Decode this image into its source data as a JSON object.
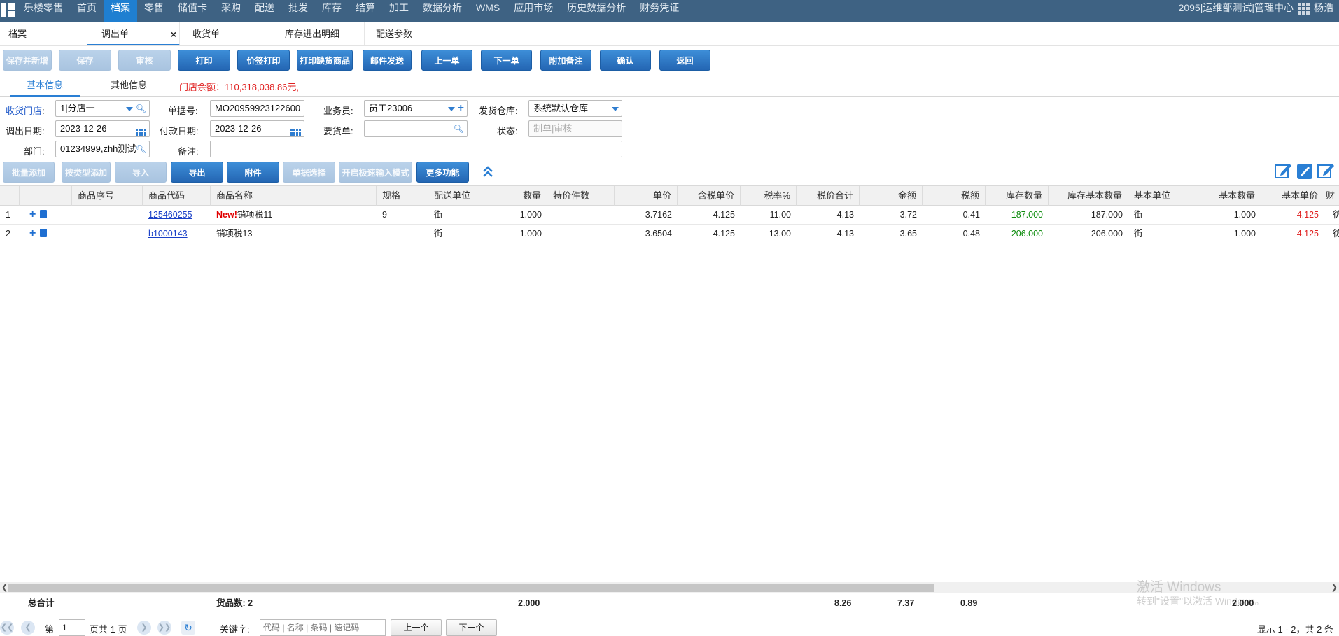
{
  "topnav": {
    "items": [
      "乐楼零售",
      "首页",
      "档案",
      "零售",
      "储值卡",
      "采购",
      "配送",
      "批发",
      "库存",
      "结算",
      "加工",
      "数据分析",
      "WMS",
      "应用市场",
      "历史数据分析",
      "财务凭证"
    ],
    "active_index": 2,
    "org": "2095|运维部测试|管理中心",
    "user": "杨浩"
  },
  "tabs": [
    {
      "label": "档案"
    },
    {
      "label": "调出单"
    },
    {
      "label": "收货单"
    },
    {
      "label": "库存进出明细"
    },
    {
      "label": "配送参数"
    }
  ],
  "tab_close": "×",
  "toolbar": {
    "buttons": [
      "保存并新增",
      "保存",
      "审核",
      "打印",
      "价签打印",
      "打印缺货商品",
      "邮件发送",
      "上一单",
      "下一单",
      "附加备注",
      "确认",
      "返回"
    ]
  },
  "subtabs": {
    "basic": "基本信息",
    "other": "其他信息",
    "balance": "门店余额：110,318,038.86元,"
  },
  "form": {
    "recv_store_label": "收货门店",
    "recv_store_value": "1|分店一",
    "bill_no_label": "单据号:",
    "bill_no_value": "MO20959923122600",
    "salesman_label": "业务员:",
    "salesman_value": "员工23006",
    "warehouse_label": "发货仓库:",
    "warehouse_value": "系统默认仓库",
    "out_date_label": "调出日期:",
    "out_date_value": "2023-12-26",
    "pay_date_label": "付款日期:",
    "pay_date_value": "2023-12-26",
    "req_bill_label": "要货单:",
    "req_bill_value": "",
    "status_label": "状态:",
    "status_placeholder": "制单|审核",
    "dept_label": "部门:",
    "dept_value": "01234999,zhh测试",
    "remark_label": "备注:",
    "remark_value": ""
  },
  "toolbar2": {
    "buttons": [
      "批量添加",
      "按类型添加",
      "导入",
      "导出",
      "附件",
      "单据选择",
      "开启极速输入模式",
      "更多功能"
    ],
    "collapse_icon": "double-chevron-up-icon"
  },
  "table": {
    "headers": [
      "商品序号",
      "商品代码",
      "商品名称",
      "规格",
      "配送单位",
      "数量",
      "特价件数",
      "单价",
      "含税单价",
      "税率%",
      "税价合计",
      "金额",
      "税额",
      "库存数量",
      "库存基本数量",
      "基本单位",
      "基本数量",
      "基本单价",
      "财"
    ],
    "rows": [
      {
        "idx": "1",
        "code": "125460255",
        "new": "New!",
        "name": "销项税11",
        "spec": "9",
        "unit": "街",
        "qty": "1.000",
        "special": "",
        "price": "3.7162",
        "tax_price": "4.125",
        "tax_rate": "11.00",
        "tax_total": "4.13",
        "amount": "3.72",
        "tax": "0.41",
        "stock": "187.000",
        "stock_base": "187.000",
        "base_unit": "街",
        "base_qty": "1.000",
        "base_price": "4.125",
        "extra": "彷"
      },
      {
        "idx": "2",
        "code": "b1000143",
        "new": "",
        "name": "销项税13",
        "spec": "",
        "unit": "街",
        "qty": "1.000",
        "special": "",
        "price": "3.6504",
        "tax_price": "4.125",
        "tax_rate": "13.00",
        "tax_total": "4.13",
        "amount": "3.65",
        "tax": "0.48",
        "stock": "206.000",
        "stock_base": "206.000",
        "base_unit": "街",
        "base_qty": "1.000",
        "base_price": "4.125",
        "extra": "彷"
      }
    ]
  },
  "totals": {
    "label": "总合计",
    "count": "货品数: 2",
    "qty": "2.000",
    "tax_total": "8.26",
    "amount": "7.37",
    "tax": "0.89",
    "base_qty": "2.000"
  },
  "pager": {
    "page_prefix": "第",
    "page_value": "1",
    "page_suffix": "页共 1 页",
    "keyword_label": "关键字:",
    "keyword_placeholder": "代码 | 名称 | 条码 | 速记码",
    "prev": "上一个",
    "next": "下一个",
    "summary": "显示 1 - 2，共 2 条"
  },
  "watermark": {
    "title": "激活 Windows",
    "sub": "转到\"设置\"以激活 Windows。"
  },
  "colors": {
    "nav_bg": "#3e6283",
    "nav_active": "#1f7fd1",
    "button": "#2a7fd4",
    "red": "#e02020",
    "green": "#0a8a0a"
  }
}
